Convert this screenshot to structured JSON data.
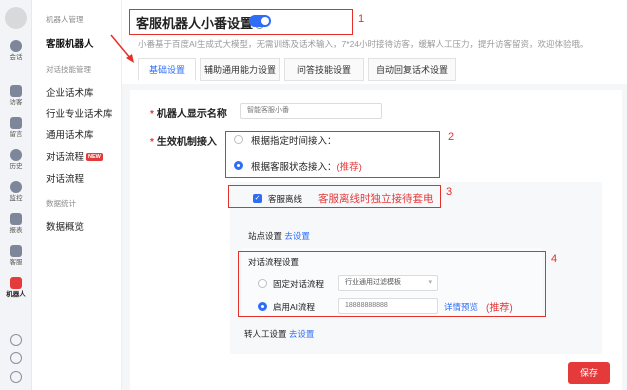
{
  "rail": {
    "items": [
      {
        "label": "会话",
        "icon": "chat-icon"
      },
      {
        "label": "访客",
        "icon": "visitors-icon"
      },
      {
        "label": "留言",
        "icon": "message-icon"
      },
      {
        "label": "历史",
        "icon": "history-icon"
      },
      {
        "label": "监控",
        "icon": "monitor-icon"
      },
      {
        "label": "报表",
        "icon": "report-icon"
      },
      {
        "label": "客服",
        "icon": "agent-icon"
      },
      {
        "label": "机器人",
        "icon": "robot-icon"
      }
    ]
  },
  "menu": {
    "group1": "机器人管理",
    "item_robot": "客服机器人",
    "group2": "对话技能管理",
    "item_enterprise": "企业话术库",
    "item_industry": "行业专业话术库",
    "item_general": "通用话术库",
    "item_flow_new": "对话流程",
    "badge_new": "NEW",
    "item_flow": "对话流程",
    "group3": "数据统计",
    "item_overview": "数据概览"
  },
  "header": {
    "title": "客服机器人小番设置",
    "help": "?",
    "subtitle": "小番基于百度AI生成式大模型，无需训练及话术输入，7*24小时接待访客，缓解人工压力，提升访客留资，欢迎体验哦。",
    "toggle_on": true
  },
  "tabs": [
    "基础设置",
    "辅助通用能力设置",
    "问答技能设置",
    "自动回复话术设置"
  ],
  "form": {
    "name_label": "机器人显示名称",
    "name_value": "智能客服小番",
    "mode_label": "生效机制接入",
    "opt_time": "根据指定时间接入：",
    "opt_status": "根据客服状态接入：",
    "opt_status_note": "(推荐)",
    "offline_label": "客服离线",
    "offline_note": "客服离线时独立接待套电",
    "site_label": "站点设置",
    "site_link": "去设置",
    "flow_title": "对话流程设置",
    "flow_fixed": "固定对话流程",
    "flow_fixed_value": "行业通用过滤模板",
    "flow_ai": "启用AI流程",
    "flow_ai_value": "18888888888",
    "flow_ai_link": "详情预览",
    "flow_ai_note": "(推荐)",
    "transfer_label": "转人工设置",
    "transfer_link": "去设置",
    "save": "保存"
  },
  "annotations": [
    "1",
    "2",
    "3",
    "4"
  ],
  "colors": {
    "accent": "#2f6df6",
    "danger": "#e53a3a",
    "annotation": "#e5302a"
  }
}
